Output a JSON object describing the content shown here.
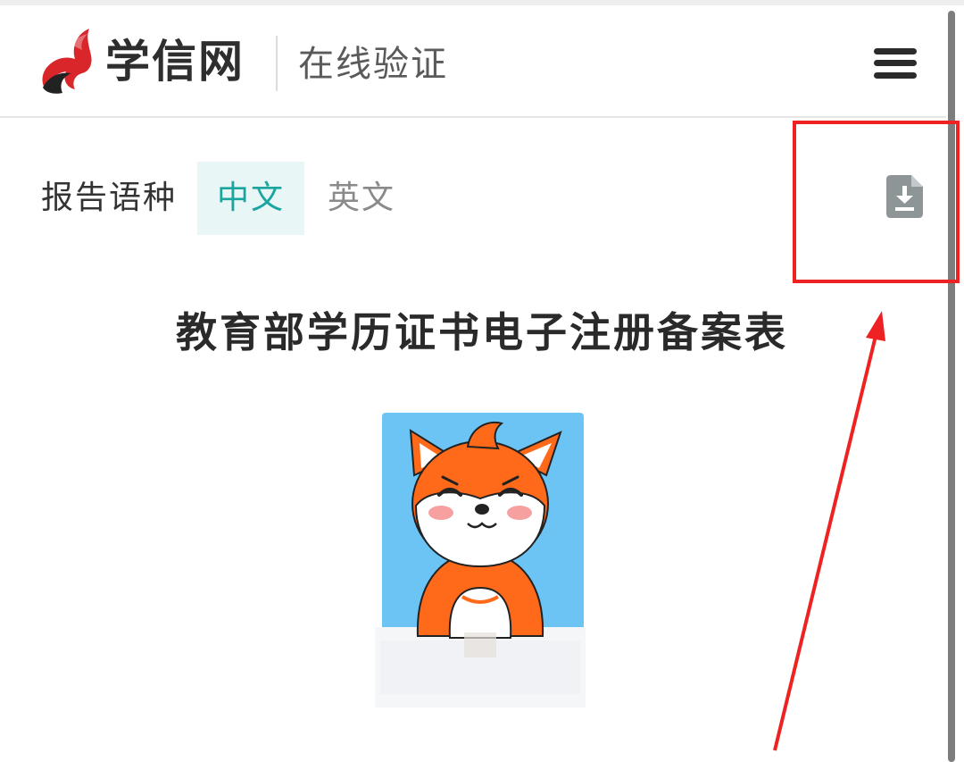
{
  "header": {
    "brand": "学信网",
    "subtitle": "在线验证",
    "menu_icon": "hamburger-menu-icon"
  },
  "report_language": {
    "label": "报告语种",
    "options": [
      "中文",
      "英文"
    ],
    "selected": "中文",
    "download_icon": "file-download-icon"
  },
  "document": {
    "title": "教育部学历证书电子注册备案表",
    "photo": "cartoon-fox-avatar"
  },
  "colors": {
    "accent": "#1ba59f",
    "tab_active_bg": "#e8f6f6",
    "logo_red": "#d8262b",
    "annotation": "#ee2222",
    "photo_bg": "#6cc4f4"
  }
}
